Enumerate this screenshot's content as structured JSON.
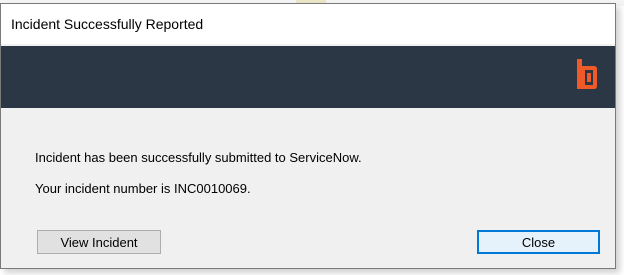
{
  "dialog": {
    "title": "Incident Successfully Reported",
    "logo_icon": "brand-logo-icon",
    "accent_color": "#f05a28",
    "banner_color": "#2b3745",
    "message_line1": "Incident has been successfully submitted to ServiceNow.",
    "message_line2": "Your incident number is INC0010069.",
    "view_button_label": "View Incident",
    "close_button_label": "Close"
  }
}
